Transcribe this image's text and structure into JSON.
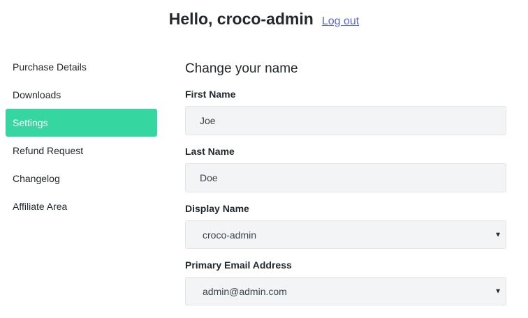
{
  "header": {
    "greeting": "Hello, croco-admin",
    "logout_label": "Log out"
  },
  "sidebar": {
    "items": [
      {
        "label": "Purchase Details"
      },
      {
        "label": "Downloads"
      },
      {
        "label": "Settings",
        "active": true
      },
      {
        "label": "Refund Request"
      },
      {
        "label": "Changelog"
      },
      {
        "label": "Affiliate Area"
      }
    ]
  },
  "main": {
    "section_title": "Change your name",
    "first_name": {
      "label": "First Name",
      "value": "Joe"
    },
    "last_name": {
      "label": "Last Name",
      "value": "Doe"
    },
    "display_name": {
      "label": "Display Name",
      "value": "croco-admin"
    },
    "email": {
      "label": "Primary Email Address",
      "value": "admin@admin.com"
    }
  },
  "colors": {
    "accent": "#35d6a0",
    "link": "#5867dd",
    "field_bg": "#f3f4f6"
  },
  "icons": {
    "select_caret": "caret-down-icon"
  }
}
